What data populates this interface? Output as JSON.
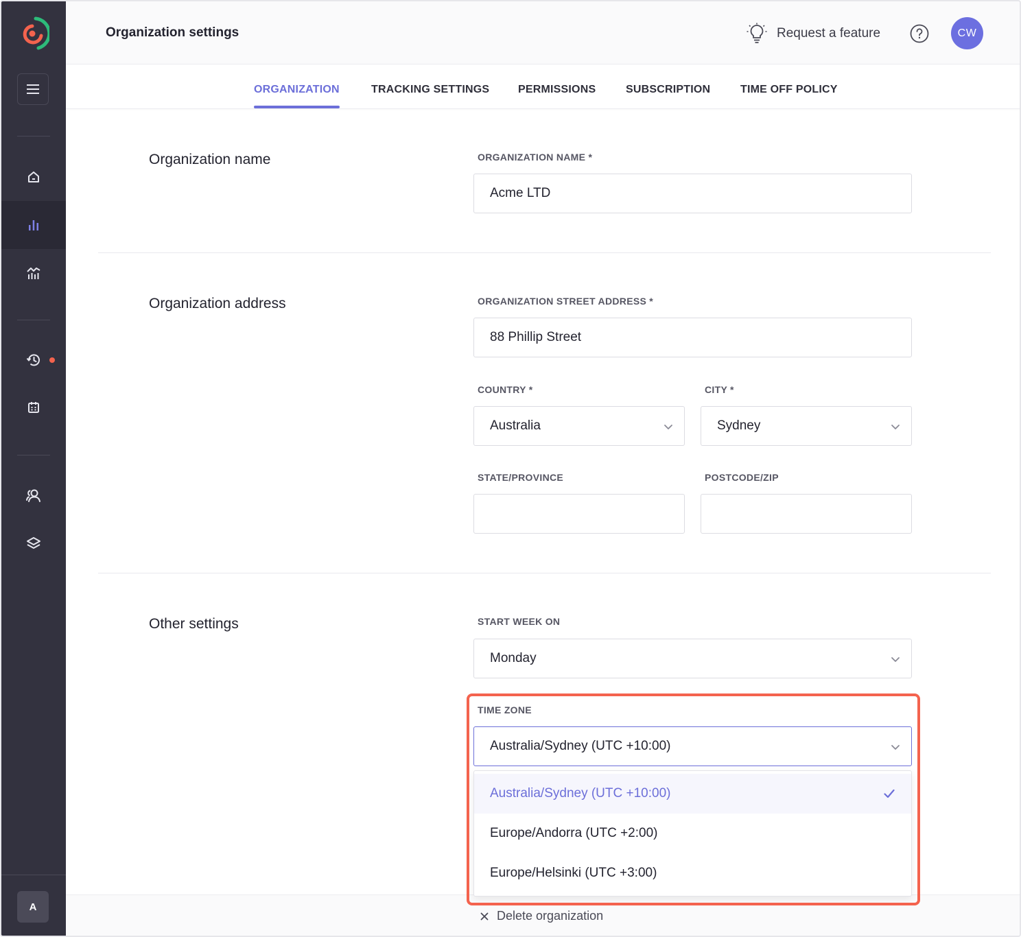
{
  "header": {
    "title": "Organization settings",
    "request_feature": "Request a feature",
    "avatar_initials": "CW"
  },
  "tabs": [
    {
      "label": "ORGANIZATION",
      "active": true
    },
    {
      "label": "TRACKING SETTINGS",
      "active": false
    },
    {
      "label": "PERMISSIONS",
      "active": false
    },
    {
      "label": "SUBSCRIPTION",
      "active": false
    },
    {
      "label": "TIME OFF POLICY",
      "active": false
    }
  ],
  "sections": {
    "name": {
      "title": "Organization name",
      "field_label": "ORGANIZATION NAME *",
      "value": "Acme LTD"
    },
    "address": {
      "title": "Organization address",
      "street_label": "ORGANIZATION STREET ADDRESS *",
      "street_value": "88 Phillip Street",
      "country_label": "COUNTRY *",
      "country_value": "Australia",
      "city_label": "CITY *",
      "city_value": "Sydney",
      "state_label": "STATE/PROVINCE",
      "state_value": "",
      "postcode_label": "POSTCODE/ZIP",
      "postcode_value": ""
    },
    "other": {
      "title": "Other settings",
      "start_week_label": "START WEEK ON",
      "start_week_value": "Monday",
      "timezone_label": "TIME ZONE",
      "timezone_value": "Australia/Sydney (UTC +10:00)",
      "timezone_options": [
        {
          "label": "Australia/Sydney (UTC +10:00)",
          "selected": true
        },
        {
          "label": "Europe/Andorra (UTC +2:00)",
          "selected": false
        },
        {
          "label": "Europe/Helsinki (UTC +3:00)",
          "selected": false
        }
      ]
    }
  },
  "footer": {
    "delete_label": "Delete organization"
  },
  "sidebar": {
    "user_initial": "A",
    "items": [
      "home-icon",
      "bar-chart-icon",
      "trend-chart-icon",
      "history-icon",
      "calendar-icon",
      "people-icon",
      "layers-icon"
    ]
  },
  "colors": {
    "accent": "#6c6fd9",
    "sidebar_bg": "#33323f",
    "highlight": "#f4634e"
  }
}
